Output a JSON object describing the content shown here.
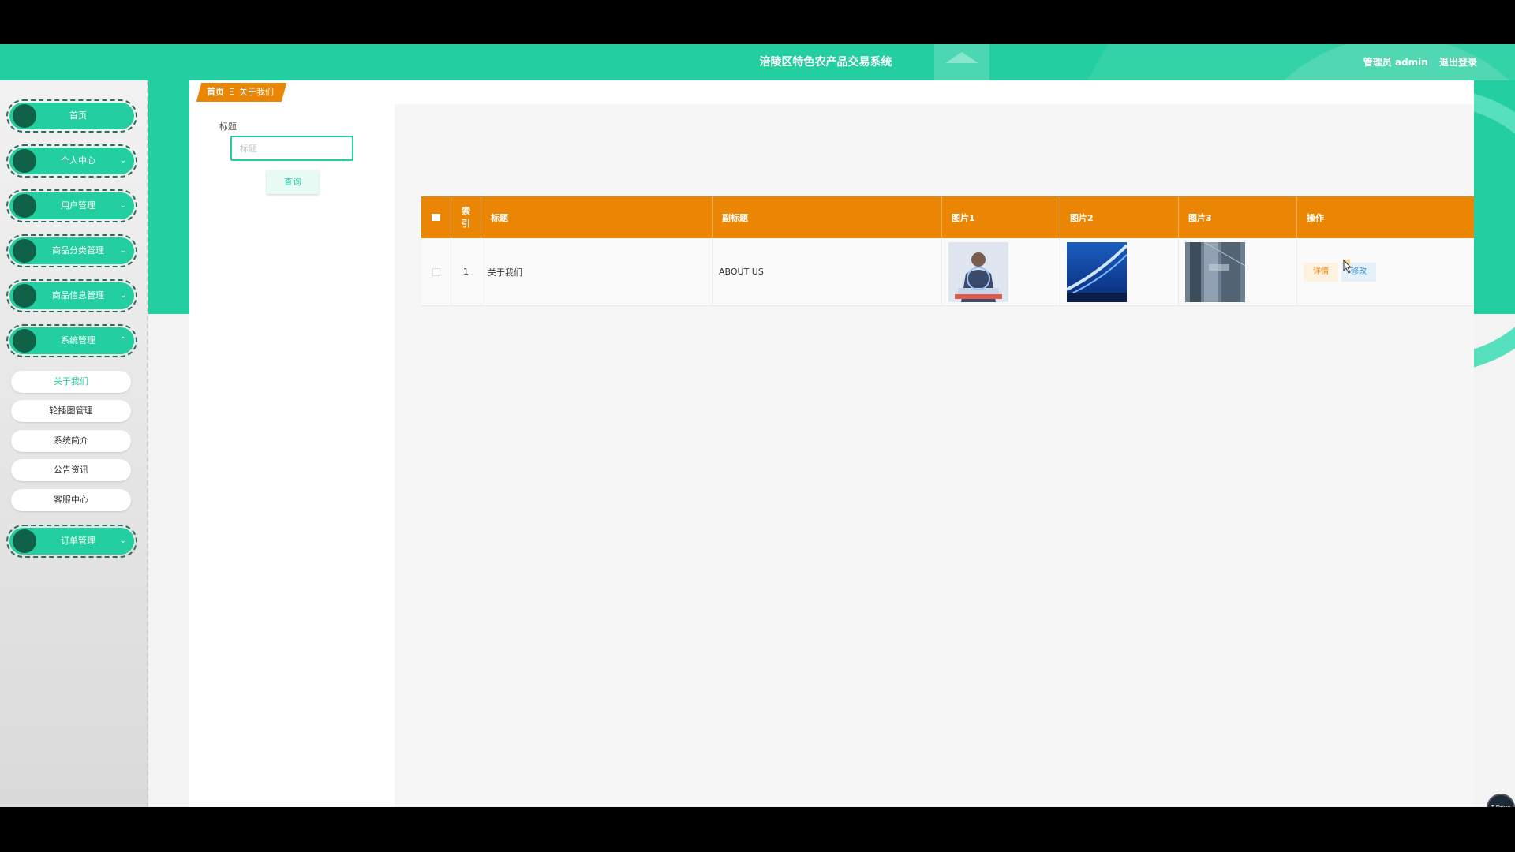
{
  "header": {
    "title": "涪陵区特色农产品交易系统",
    "role_user": "管理员 admin",
    "logout": "退出登录"
  },
  "sidebar": {
    "items": [
      {
        "label": "首页",
        "chevron": ""
      },
      {
        "label": "个人中心",
        "chevron": "⌄"
      },
      {
        "label": "用户管理",
        "chevron": "⌄"
      },
      {
        "label": "商品分类管理",
        "chevron": "⌄"
      },
      {
        "label": "商品信息管理",
        "chevron": "⌄"
      },
      {
        "label": "系统管理",
        "chevron": "⌃"
      },
      {
        "label": "订单管理",
        "chevron": "⌄"
      }
    ],
    "submenu": [
      {
        "label": "关于我们"
      },
      {
        "label": "轮播图管理"
      },
      {
        "label": "系统简介"
      },
      {
        "label": "公告资讯"
      },
      {
        "label": "客服中心"
      }
    ]
  },
  "breadcrumb": {
    "home": "首页",
    "separator": "Ξ",
    "current": "关于我们"
  },
  "search": {
    "label": "标题",
    "placeholder": "标题",
    "button": "查询"
  },
  "table": {
    "headers": [
      "索引",
      "标题",
      "副标题",
      "图片1",
      "图片2",
      "图片3",
      "操作"
    ],
    "rows": [
      {
        "index": "1",
        "title": "关于我们",
        "subtitle": "ABOUT US",
        "detail": "详情",
        "edit": "修改"
      }
    ]
  },
  "fab": {
    "label": "T-Drive"
  },
  "colors": {
    "brand_green": "#23cfa0",
    "dark_green": "#0f6148",
    "table_header_orange": "#eb8504"
  }
}
